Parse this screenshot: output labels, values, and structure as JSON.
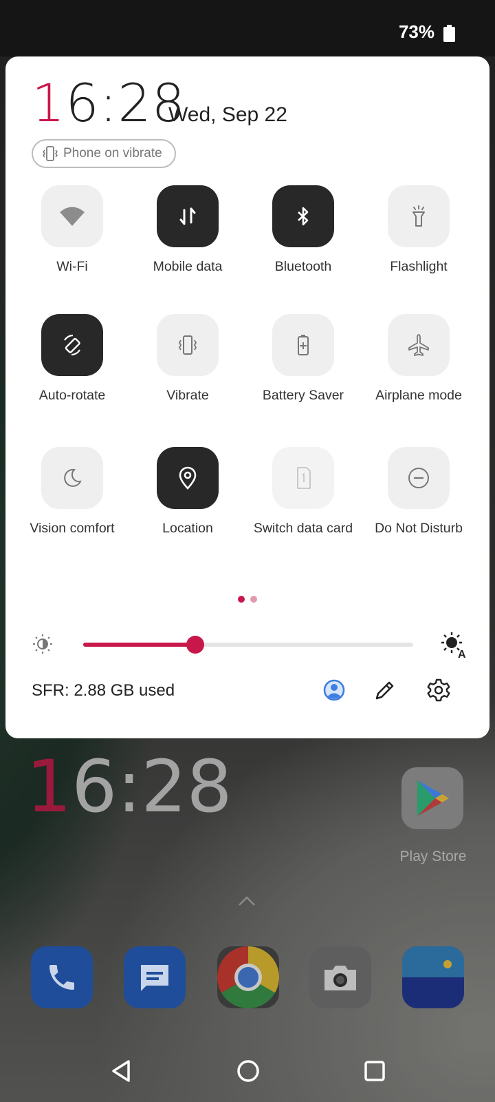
{
  "status_bar": {
    "battery_percent": "73%",
    "battery_icon": "battery-icon"
  },
  "panel": {
    "clock_hour_first": "1",
    "clock_rest": "6:28",
    "date": "Wed, Sep 22",
    "ringer_chip": {
      "label": "Phone on vibrate",
      "icon": "vibrate-icon"
    },
    "tiles": [
      {
        "label": "Wi-Fi",
        "icon": "wifi-icon",
        "on": false
      },
      {
        "label": "Mobile data",
        "icon": "mobile-data-icon",
        "on": true
      },
      {
        "label": "Bluetooth",
        "icon": "bluetooth-icon",
        "on": true
      },
      {
        "label": "Flashlight",
        "icon": "flashlight-icon",
        "on": false
      },
      {
        "label": "Auto-rotate",
        "icon": "auto-rotate-icon",
        "on": true
      },
      {
        "label": "Vibrate",
        "icon": "vibrate-icon",
        "on": false
      },
      {
        "label": "Battery Saver",
        "icon": "battery-saver-icon",
        "on": false
      },
      {
        "label": "Airplane mode",
        "icon": "airplane-icon",
        "on": false
      },
      {
        "label": "Vision comfort",
        "icon": "moon-icon",
        "on": false
      },
      {
        "label": "Location",
        "icon": "location-pin-icon",
        "on": true
      },
      {
        "label": "Switch data card",
        "icon": "sim-card-icon",
        "on": false
      },
      {
        "label": "Do Not Disturb",
        "icon": "do-not-disturb-icon",
        "on": false
      }
    ],
    "page_indicator": {
      "current": 1,
      "total": 2
    },
    "brightness": {
      "level": 0.34
    },
    "data_usage": "SFR: 2.88 GB used",
    "footer_icons": [
      "user-account-icon",
      "edit-pencil-icon",
      "settings-gear-icon"
    ]
  },
  "home": {
    "clock_hour_first": "1",
    "clock_rest": "6:28",
    "apps": [
      {
        "label": "Play Store",
        "icon": "play-store-icon"
      }
    ],
    "dock": [
      "phone-icon",
      "messages-icon",
      "chrome-icon",
      "camera-icon",
      "gallery-icon"
    ]
  },
  "nav_bar": [
    "back-icon",
    "home-icon",
    "recents-icon"
  ],
  "colors": {
    "accent": "#c8174a",
    "tile_on": "#282828",
    "tile_off": "#efefef"
  }
}
